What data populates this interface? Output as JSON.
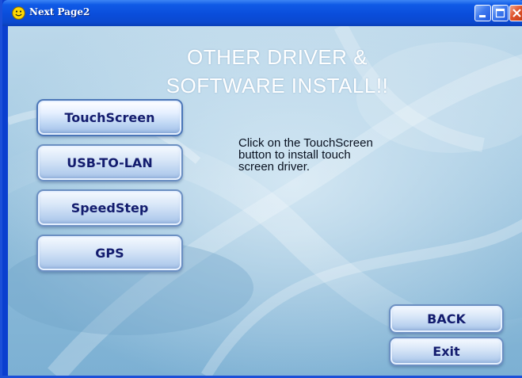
{
  "window": {
    "title": "Next Page2",
    "icon": "smiley-icon",
    "controls": [
      "minimize-icon",
      "maximize-icon",
      "close-icon"
    ]
  },
  "heading": {
    "line1": "OTHER DRIVER &",
    "line2": "SOFTWARE INSTALL!!"
  },
  "menu": {
    "items": [
      {
        "label": "TouchScreen",
        "active": true
      },
      {
        "label": "USB-TO-LAN",
        "active": false
      },
      {
        "label": "SpeedStep",
        "active": false
      },
      {
        "label": "GPS",
        "active": false
      }
    ]
  },
  "description": {
    "lines": [
      "Click on the TouchScreen",
      "button to install touch",
      "screen driver."
    ]
  },
  "nav": {
    "back_label": "BACK",
    "exit_label": "Exit"
  },
  "colors": {
    "titlebar": "#0a4ddb",
    "background": "#a9cde4",
    "button_text": "#131c6e",
    "heading_text": "#ffffff"
  }
}
